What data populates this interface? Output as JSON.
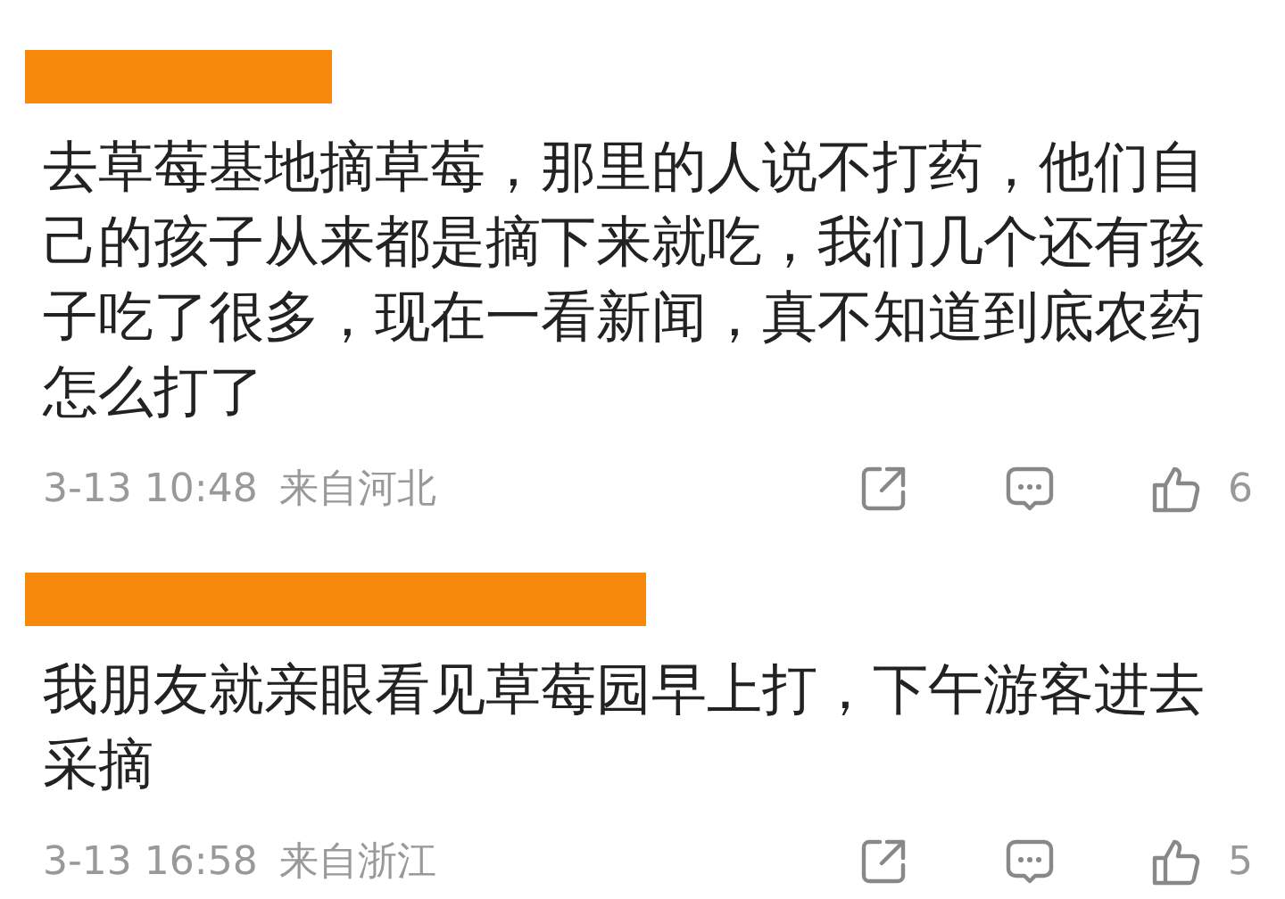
{
  "comments": [
    {
      "text": "去草莓基地摘草莓，那里的人说不打药，他们自己的孩子从来都是摘下来就吃，我们几个还有孩子吃了很多，现在一看新闻，真不知道到底农药怎么打了",
      "time": "3-13 10:48",
      "location": "来自河北",
      "likes": "6"
    },
    {
      "text": "我朋友就亲眼看见草莓园早上打，下午游客进去采摘",
      "time": "3-13 16:58",
      "location": "来自浙江",
      "likes": "5"
    }
  ]
}
